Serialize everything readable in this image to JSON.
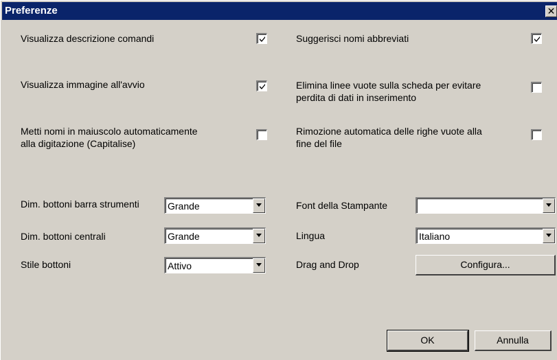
{
  "window": {
    "title": "Preferenze",
    "close_glyph": "✕"
  },
  "options": [
    {
      "label": "Visualizza descrizione comandi",
      "checked": true
    },
    {
      "label": "Suggerisci nomi abbreviati",
      "checked": true
    },
    {
      "label": "Visualizza immagine all'avvio",
      "checked": true
    },
    {
      "label_line1": "Elimina linee vuote sulla scheda per evitare",
      "label_line2": "perdita di dati in inserimento",
      "checked": false
    },
    {
      "label_line1": "Metti nomi in maiuscolo automaticamente",
      "label_line2": "alla  digitazione (Capitalise)",
      "checked": false
    },
    {
      "label_line1": "Rimozione automatica delle righe vuote alla",
      "label_line2": "fine del file",
      "checked": false
    }
  ],
  "settings": {
    "toolbar_buttons_size": {
      "label": "Dim. bottoni barra strumenti",
      "value": "Grande"
    },
    "center_buttons_size": {
      "label": "Dim. bottoni centrali",
      "value": "Grande"
    },
    "button_style": {
      "label": "Stile bottoni",
      "value": "Attivo"
    },
    "printer_font": {
      "label": "Font della Stampante",
      "value": ""
    },
    "language": {
      "label": "Lingua",
      "value": "Italiano"
    },
    "drag_drop": {
      "label": "Drag and Drop",
      "button": "Configura..."
    }
  },
  "actions": {
    "ok": "OK",
    "cancel": "Annulla"
  },
  "colors": {
    "titlebar": "#0a246a",
    "face": "#d4d0c8"
  }
}
